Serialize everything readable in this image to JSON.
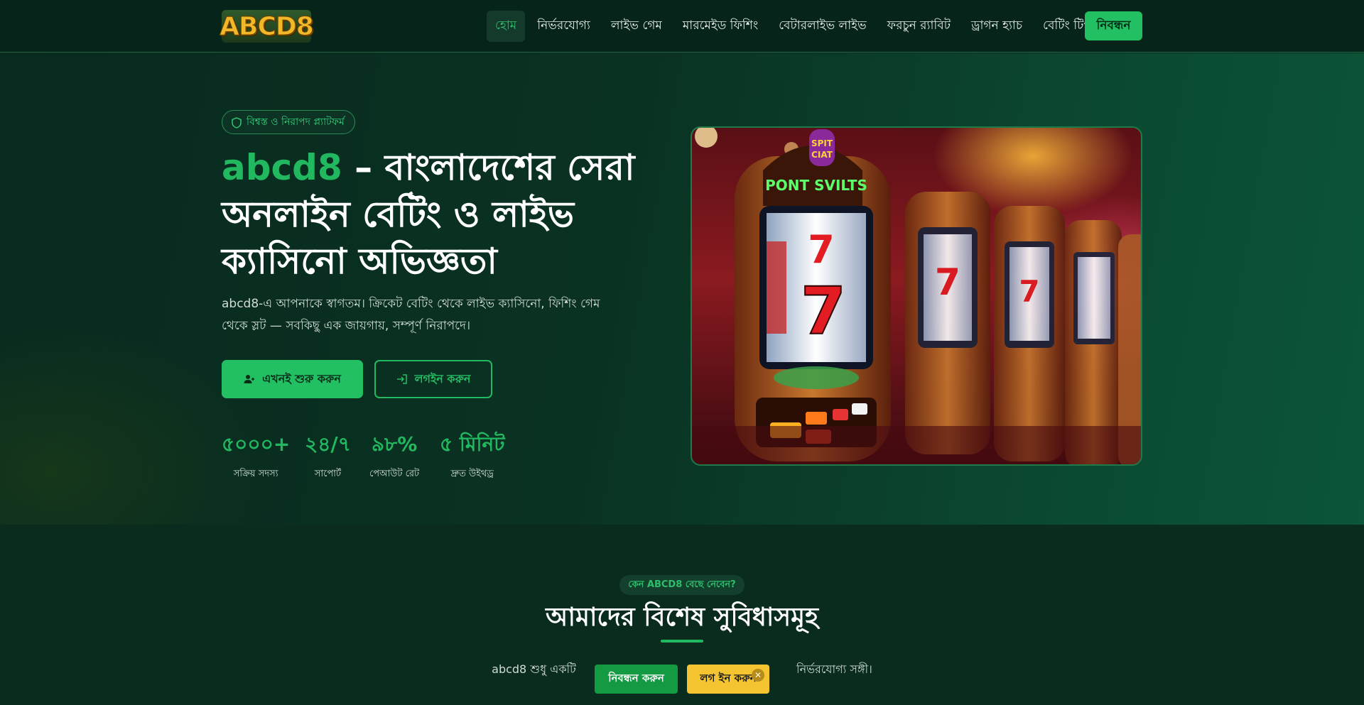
{
  "nav": {
    "logo_text": "ABCD8",
    "items": [
      {
        "label": "হোম",
        "active": true
      },
      {
        "label": "নির্ভরযোগ্য"
      },
      {
        "label": "লাইভ গেম"
      },
      {
        "label": "মারমেইড ফিশিং"
      },
      {
        "label": "বেটারলাইভ লাইভ"
      },
      {
        "label": "ফরচুন র‍্যাবিট"
      },
      {
        "label": "ড্রাগন হ্যাচ"
      },
      {
        "label": "বেটিং টিপস"
      }
    ],
    "cta_label": "নিবন্ধন"
  },
  "hero": {
    "badge_text": "বিশ্বস্ত ও নিরাপদ প্ল্যাটফর্ম",
    "title_accent": "abcd8",
    "title_rest": " – বাংলাদেশের সেরা অনলাইন বেটিং ও লাইভ ক্যাসিনো অভিজ্ঞতা",
    "description": "abcd8-এ আপনাকে স্বাগতম। ক্রিকেট বেটিং থেকে লাইভ ক্যাসিনো, ফিশিং গেম থেকে স্লট — সবকিছু এক জায়গায়, সম্পূর্ণ নিরাপদে।",
    "primary_button": "এখনই শুরু করুন",
    "secondary_button": "লগইন করুন",
    "stats": [
      {
        "value": "৫০০০+",
        "label": "সক্রিয় সদস্য"
      },
      {
        "value": "২৪/৭",
        "label": "সাপোর্ট"
      },
      {
        "value": "৯৮%",
        "label": "পেআউট রেট"
      },
      {
        "value": "৫ মিনিট",
        "label": "দ্রুত উইথড্র"
      }
    ]
  },
  "features": {
    "pill": "কেন ABCD8 বেছে নেবেন?",
    "title": "আমাদের বিশেষ সুবিধাসমূহ",
    "desc_left": "abcd8 শুধু একটি",
    "desc_right": "নির্ভরযোগ্য সঙ্গী।"
  },
  "floating": {
    "register_label": "নিবন্ধন করুন",
    "login_label": "লগ ইন করুন",
    "close_glyph": "✕"
  },
  "colors": {
    "brand_green": "#22c063",
    "accent_yellow": "#f5c531",
    "background": "#0b2a1d"
  }
}
